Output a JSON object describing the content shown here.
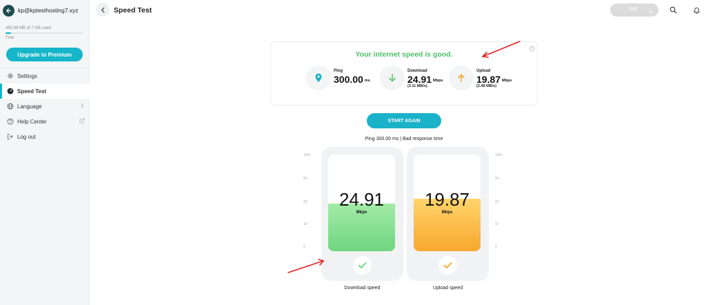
{
  "sidebar": {
    "account_email": "kp@kptesthosting7.xyz",
    "storage_text": "492.99 MB of 7 GB used",
    "storage_fraction": 0.07,
    "plan": "Free",
    "upgrade_label": "Upgrade to Premium",
    "items": [
      {
        "label": "Settings",
        "icon": "gear-icon",
        "active": false
      },
      {
        "label": "Speed Test",
        "icon": "speedometer-icon",
        "active": true
      },
      {
        "label": "Language",
        "icon": "globe-icon",
        "active": false,
        "trailing": "chevron-right-icon"
      },
      {
        "label": "Help Center",
        "icon": "help-circle-icon",
        "active": false,
        "trailing": "external-link-icon"
      },
      {
        "label": "Log out",
        "icon": "logout-icon",
        "active": false
      }
    ]
  },
  "header": {
    "title": "Speed Test",
    "add_label": "Add",
    "icons": [
      "search-icon",
      "bell-icon"
    ]
  },
  "result": {
    "headline": "Your internet speed is good.",
    "headline_color": "#4cbf6a",
    "metrics": [
      {
        "label": "Ping",
        "value": "300.00",
        "unit": "ms",
        "sub": "",
        "icon": "location-pin-icon",
        "icon_color": "#1ab2c8"
      },
      {
        "label": "Download",
        "value": "24.91",
        "unit": "Mbps",
        "sub": "(3.11 MB/s)",
        "icon": "arrow-down-icon",
        "icon_color": "#5cc46f"
      },
      {
        "label": "Upload",
        "value": "19.87",
        "unit": "Mbps",
        "sub": "(2.48 MB/s)",
        "icon": "arrow-up-icon",
        "icon_color": "#f5a623"
      }
    ]
  },
  "start_again_label": "START AGAIN",
  "ping_status": "Ping 300.00 ms | Bad response time",
  "scale_ticks": [
    "100+",
    "50",
    "20",
    "10",
    "0"
  ],
  "gauges": [
    {
      "value": "24.91",
      "unit": "Mbps",
      "caption": "Download speed",
      "fill_fraction": 0.49,
      "color_top": "#a2eba7",
      "color_bottom": "#6fd67f",
      "check_color": "#6fd67f"
    },
    {
      "value": "19.87",
      "unit": "Mbps",
      "caption": "Upload speed",
      "fill_fraction": 0.54,
      "color_top": "#ffd46b",
      "color_bottom": "#f7a82e",
      "check_color": "#f5a623"
    }
  ],
  "colors": {
    "accent": "#16b5c9",
    "annotation": "#e02020"
  }
}
